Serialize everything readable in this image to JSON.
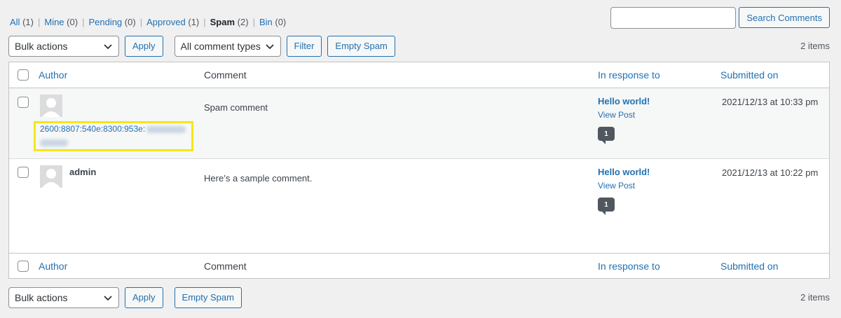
{
  "filters": [
    {
      "label": "All",
      "count": "(1)",
      "current": false
    },
    {
      "label": "Mine",
      "count": "(0)",
      "current": false
    },
    {
      "label": "Pending",
      "count": "(0)",
      "current": false
    },
    {
      "label": "Approved",
      "count": "(1)",
      "current": false
    },
    {
      "label": "Spam",
      "count": "(2)",
      "current": true
    },
    {
      "label": "Bin",
      "count": "(0)",
      "current": false
    }
  ],
  "search": {
    "placeholder": "",
    "button_label": "Search Comments"
  },
  "top_nav": {
    "bulk_actions": "Bulk actions",
    "apply": "Apply",
    "comment_types": "All comment types",
    "filter": "Filter",
    "empty_spam": "Empty Spam",
    "items": "2 items"
  },
  "bottom_nav": {
    "bulk_actions": "Bulk actions",
    "apply": "Apply",
    "empty_spam": "Empty Spam",
    "items": "2 items"
  },
  "table": {
    "headers": {
      "author": "Author",
      "comment": "Comment",
      "in_response_to": "In response to",
      "submitted_on": "Submitted on"
    },
    "rows": [
      {
        "author_name": "",
        "author_ip": "2600:8807:540e:8300:953e:",
        "comment": "Spam comment",
        "post_title": "Hello world!",
        "view_post": "View Post",
        "comment_count": "1",
        "submitted": "2021/12/13 at 10:33 pm"
      },
      {
        "author_name": "admin",
        "author_ip": "",
        "comment": "Here’s a sample comment.",
        "post_title": "Hello world!",
        "view_post": "View Post",
        "comment_count": "1",
        "submitted": "2021/12/13 at 10:22 pm"
      }
    ]
  },
  "icons": {
    "dropdown": "chevron-down-icon",
    "avatar": "default-avatar-icon",
    "count_bubble": "comment-bubble-icon"
  },
  "colors": {
    "link": "#2271b1",
    "highlight": "#f5e61a",
    "bubble": "#50575e"
  }
}
